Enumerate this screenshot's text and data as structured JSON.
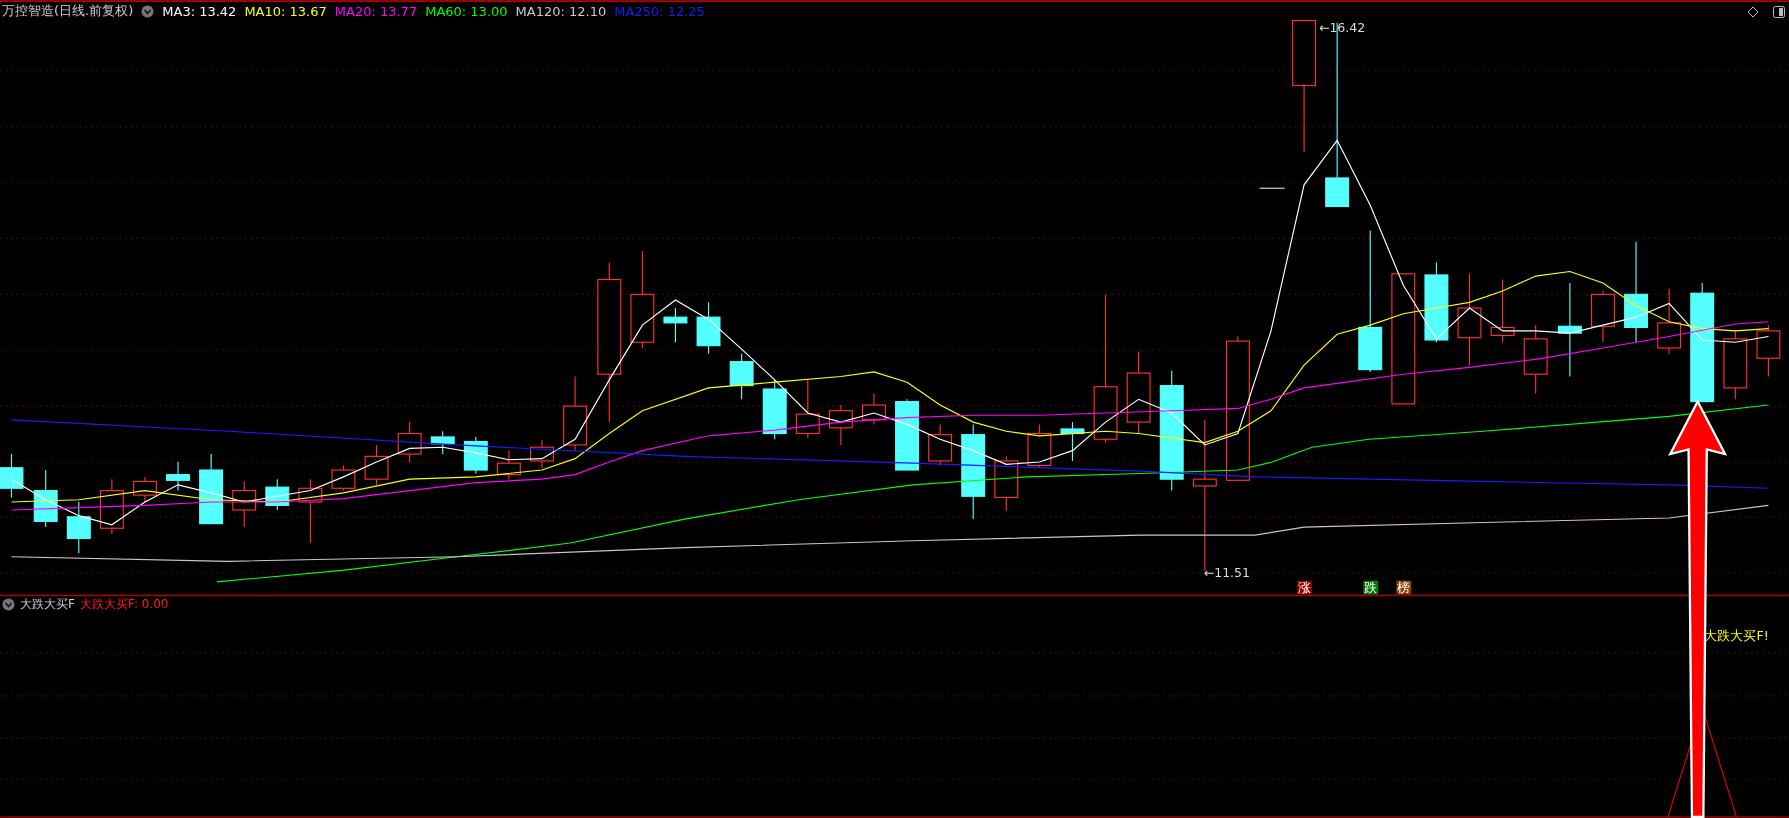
{
  "header": {
    "title": "万控智造(日线.前复权)",
    "indicators": [
      {
        "label": "MA3: 13.42",
        "color": "#ffffff"
      },
      {
        "label": "MA10: 13.67",
        "color": "#ffff00"
      },
      {
        "label": "MA20: 13.77",
        "color": "#ff00ff"
      },
      {
        "label": "MA60: 13.00",
        "color": "#00ff00"
      },
      {
        "label": "MA120: 12.10",
        "color": "#c8c8c8"
      },
      {
        "label": "MA250: 12.25",
        "color": "#1a1aff"
      }
    ]
  },
  "price_labels": {
    "high": "←16.42",
    "low": "←11.51"
  },
  "badges": [
    {
      "text": "涨",
      "color": "#8b0000"
    },
    {
      "text": "跌",
      "color": "#007a00"
    },
    {
      "text": "榜",
      "color": "#8b4000"
    }
  ],
  "sub_panel": {
    "title": "大跌大买F",
    "value": "大跌大买F: 0.00",
    "signal": "大跌大买F!"
  }
}
